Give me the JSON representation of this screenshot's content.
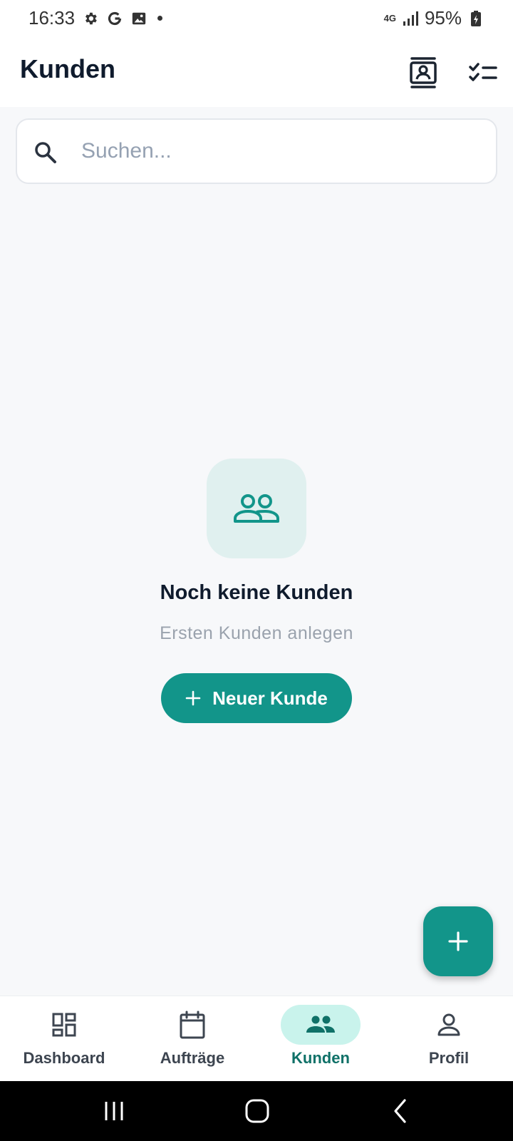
{
  "status_bar": {
    "time": "16:33",
    "left_icons": [
      "gear-icon",
      "google-icon",
      "image-icon",
      "notification-dot"
    ],
    "network": "4G",
    "battery": "95%"
  },
  "header": {
    "title": "Kunden",
    "actions": [
      "contact-card-icon",
      "checklist-icon"
    ]
  },
  "search": {
    "placeholder": "Suchen...",
    "value": ""
  },
  "empty_state": {
    "icon": "people-icon",
    "title": "Noch keine Kunden",
    "subtitle": "Ersten Kunden anlegen",
    "button_label": "Neuer Kunde"
  },
  "fab": {
    "icon": "plus-icon"
  },
  "bottom_nav": {
    "items": [
      {
        "label": "Dashboard",
        "icon": "dashboard-icon",
        "active": false
      },
      {
        "label": "Aufträge",
        "icon": "calendar-icon",
        "active": false
      },
      {
        "label": "Kunden",
        "icon": "people-icon",
        "active": true
      },
      {
        "label": "Profil",
        "icon": "person-icon",
        "active": false
      }
    ]
  },
  "colors": {
    "accent": "#12958a",
    "accent_dark": "#0f7168",
    "active_pill": "#c9f3ec",
    "empty_icon_bg": "#e0f0ef",
    "background": "#f7f8fa",
    "title_text": "#0f1b2d"
  }
}
